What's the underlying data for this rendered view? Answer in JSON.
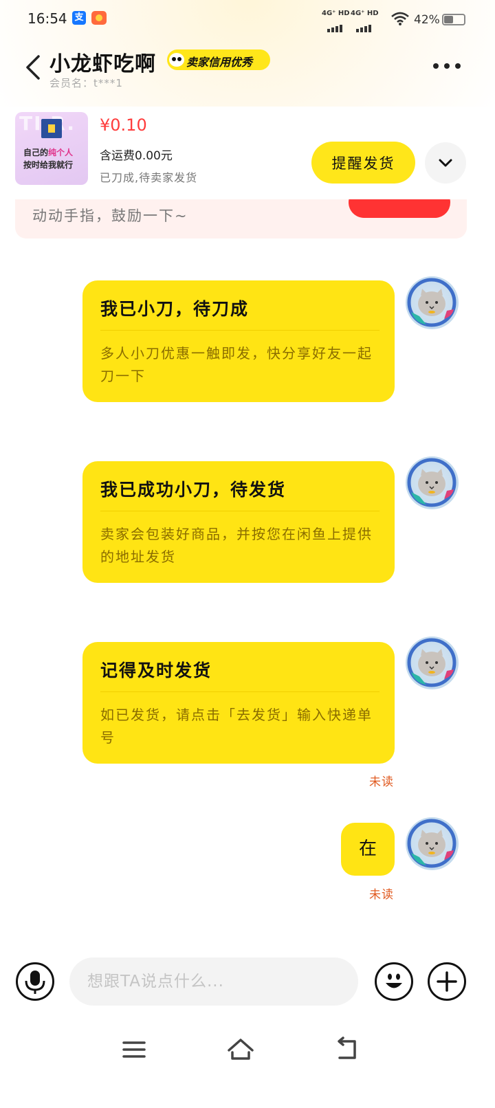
{
  "status_bar": {
    "time": "16:54",
    "alipay_glyph": "支",
    "signal1_label": "4G⁺ HD",
    "signal2_label": "4G⁺ HD",
    "battery": "42%",
    "battery_level": 0.42
  },
  "header": {
    "seller_name": "小龙虾吃啊",
    "credit_badge": "卖家信用优秀",
    "member_label": "会员名：t***1"
  },
  "product": {
    "thumb_ghost_text": "TI  R.",
    "thumb_line1_pre": "自己的",
    "thumb_line1_hl": "纯个人",
    "thumb_line2": "按时给我就行",
    "price": "¥0.10",
    "shipping": "含运费0.00元",
    "status": "已刀成,待卖家发货",
    "remind_button": "提醒发货"
  },
  "tip": {
    "text": "动动手指，鼓励一下~"
  },
  "messages": [
    {
      "title": "我已小刀，待刀成",
      "body": "多人小刀优惠一触即发，快分享好友一起刀一下"
    },
    {
      "title": "我已成功小刀，待发货",
      "body": "卖家会包装好商品，并按您在闲鱼上提供的地址发货"
    },
    {
      "title": "记得及时发货",
      "body": "如已发货，请点击「去发货」输入快递单号",
      "status": "未读"
    },
    {
      "text": "在",
      "status": "未读"
    }
  ],
  "input": {
    "placeholder": "想跟TA说点什么..."
  },
  "colors": {
    "brand_yellow": "#ffe414",
    "price_red": "#ff3c3c",
    "unread_orange": "#e05a20"
  }
}
